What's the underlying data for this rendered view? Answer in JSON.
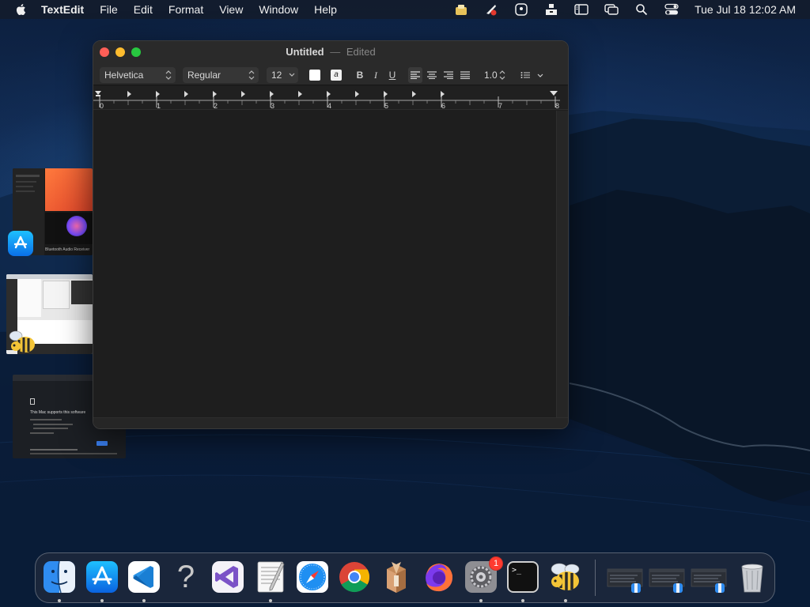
{
  "menubar": {
    "app_name": "TextEdit",
    "menus": [
      "File",
      "Edit",
      "Format",
      "View",
      "Window",
      "Help"
    ],
    "clock": "Tue Jul 18  12:02 AM",
    "status_icons": [
      "clipboard-icon",
      "creative-cloud-icon",
      "focus-icon",
      "archive-icon",
      "sidebar-icon",
      "screen-mirroring-icon",
      "search-icon",
      "control-center-icon"
    ]
  },
  "window": {
    "title": "Untitled",
    "separator": "—",
    "state": "Edited",
    "toolbar": {
      "font_family": "Helvetica",
      "font_style": "Regular",
      "font_size": "12",
      "bold": "B",
      "italic": "I",
      "underline": "U",
      "line_spacing": "1.0",
      "highlight_glyph": "a"
    },
    "ruler_numbers": [
      "0",
      "1",
      "2",
      "3",
      "4",
      "5",
      "6",
      "7",
      "8"
    ]
  },
  "thumbnails": {
    "thumb1_caption": "Bluetooth Audio Receiver",
    "thumb3_heading": "This Mac supports this software",
    "thumb3_link": "Download"
  },
  "dock": {
    "items": [
      {
        "name": "finder-icon",
        "running": true
      },
      {
        "name": "app-store-icon",
        "running": true
      },
      {
        "name": "visual-studio-code-icon",
        "running": true
      },
      {
        "name": "unknown-app-icon",
        "running": false
      },
      {
        "name": "visual-studio-icon",
        "running": false
      },
      {
        "name": "textedit-icon",
        "running": true
      },
      {
        "name": "safari-icon",
        "running": false
      },
      {
        "name": "chrome-icon",
        "running": false
      },
      {
        "name": "package-installer-icon",
        "running": false
      },
      {
        "name": "firefox-icon",
        "running": false
      },
      {
        "name": "system-preferences-icon",
        "running": true
      },
      {
        "name": "terminal-icon",
        "running": true
      },
      {
        "name": "cyberduck-icon",
        "running": true
      }
    ],
    "system_prefs_badge": "1",
    "terminal_prompt": ">_",
    "unknown_glyph": "?"
  }
}
